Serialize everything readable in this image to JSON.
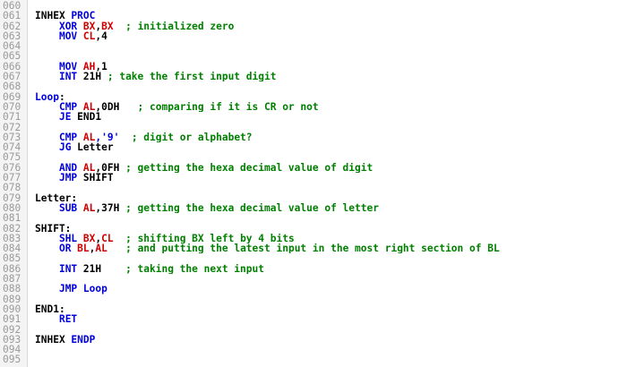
{
  "colors": {
    "background": "#ffffff",
    "line_number": "#9a9a9a",
    "identifier": "#000000",
    "keyword": "#0000dd",
    "register": "#d00000",
    "comment": "#008000"
  },
  "editor": {
    "lines": [
      {
        "n": "060",
        "tokens": []
      },
      {
        "n": "061",
        "tokens": [
          {
            "t": "INHEX ",
            "c": "code"
          },
          {
            "t": "PROC",
            "c": "kw"
          }
        ]
      },
      {
        "n": "062",
        "tokens": [
          {
            "t": "    ",
            "c": "code"
          },
          {
            "t": "XOR ",
            "c": "kw"
          },
          {
            "t": "BX",
            "c": "reg"
          },
          {
            "t": ",",
            "c": "code"
          },
          {
            "t": "BX",
            "c": "reg"
          },
          {
            "t": "  ; initialized zero",
            "c": "cmt"
          }
        ]
      },
      {
        "n": "063",
        "tokens": [
          {
            "t": "    ",
            "c": "code"
          },
          {
            "t": "MOV ",
            "c": "kw"
          },
          {
            "t": "CL",
            "c": "reg"
          },
          {
            "t": ",4",
            "c": "code"
          }
        ]
      },
      {
        "n": "064",
        "tokens": []
      },
      {
        "n": "065",
        "tokens": []
      },
      {
        "n": "066",
        "tokens": [
          {
            "t": "    ",
            "c": "code"
          },
          {
            "t": "MOV ",
            "c": "kw"
          },
          {
            "t": "AH",
            "c": "reg"
          },
          {
            "t": ",1",
            "c": "code"
          }
        ]
      },
      {
        "n": "067",
        "tokens": [
          {
            "t": "    ",
            "c": "code"
          },
          {
            "t": "INT ",
            "c": "kw"
          },
          {
            "t": "21H",
            "c": "code"
          },
          {
            "t": " ; take the first input digit",
            "c": "cmt"
          }
        ]
      },
      {
        "n": "068",
        "tokens": []
      },
      {
        "n": "069",
        "tokens": [
          {
            "t": "Loop",
            "c": "kw"
          },
          {
            "t": ":",
            "c": "code"
          }
        ]
      },
      {
        "n": "070",
        "tokens": [
          {
            "t": "    ",
            "c": "code"
          },
          {
            "t": "CMP ",
            "c": "kw"
          },
          {
            "t": "AL",
            "c": "reg"
          },
          {
            "t": ",0DH",
            "c": "code"
          },
          {
            "t": "   ; comparing if it is CR or not",
            "c": "cmt"
          }
        ]
      },
      {
        "n": "071",
        "tokens": [
          {
            "t": "    ",
            "c": "code"
          },
          {
            "t": "JE ",
            "c": "kw"
          },
          {
            "t": "END1",
            "c": "code"
          }
        ]
      },
      {
        "n": "072",
        "tokens": []
      },
      {
        "n": "073",
        "tokens": [
          {
            "t": "    ",
            "c": "code"
          },
          {
            "t": "CMP ",
            "c": "kw"
          },
          {
            "t": "AL",
            "c": "reg"
          },
          {
            "t": ",'9'",
            "c": "kw"
          },
          {
            "t": "  ; digit or alphabet?",
            "c": "cmt"
          }
        ]
      },
      {
        "n": "074",
        "tokens": [
          {
            "t": "    ",
            "c": "code"
          },
          {
            "t": "JG ",
            "c": "kw"
          },
          {
            "t": "Letter",
            "c": "code"
          }
        ]
      },
      {
        "n": "075",
        "tokens": []
      },
      {
        "n": "076",
        "tokens": [
          {
            "t": "    ",
            "c": "code"
          },
          {
            "t": "AND ",
            "c": "kw"
          },
          {
            "t": "AL",
            "c": "reg"
          },
          {
            "t": ",0FH",
            "c": "code"
          },
          {
            "t": " ; getting the hexa decimal value of digit",
            "c": "cmt"
          }
        ]
      },
      {
        "n": "077",
        "tokens": [
          {
            "t": "    ",
            "c": "code"
          },
          {
            "t": "JMP ",
            "c": "kw"
          },
          {
            "t": "SHIFT",
            "c": "code"
          }
        ]
      },
      {
        "n": "078",
        "tokens": []
      },
      {
        "n": "079",
        "tokens": [
          {
            "t": "Letter:",
            "c": "code"
          }
        ]
      },
      {
        "n": "080",
        "tokens": [
          {
            "t": "    ",
            "c": "code"
          },
          {
            "t": "SUB ",
            "c": "kw"
          },
          {
            "t": "AL",
            "c": "reg"
          },
          {
            "t": ",37H",
            "c": "code"
          },
          {
            "t": " ; getting the hexa decimal value of letter",
            "c": "cmt"
          }
        ]
      },
      {
        "n": "081",
        "tokens": []
      },
      {
        "n": "082",
        "tokens": [
          {
            "t": "SHIFT:",
            "c": "code"
          }
        ]
      },
      {
        "n": "083",
        "tokens": [
          {
            "t": "    ",
            "c": "code"
          },
          {
            "t": "SHL ",
            "c": "kw"
          },
          {
            "t": "BX",
            "c": "reg"
          },
          {
            "t": ",",
            "c": "code"
          },
          {
            "t": "CL",
            "c": "reg"
          },
          {
            "t": "  ; shifting BX left by 4 bits",
            "c": "cmt"
          }
        ]
      },
      {
        "n": "084",
        "tokens": [
          {
            "t": "    ",
            "c": "code"
          },
          {
            "t": "OR ",
            "c": "kw"
          },
          {
            "t": "BL",
            "c": "reg"
          },
          {
            "t": ",",
            "c": "code"
          },
          {
            "t": "AL",
            "c": "reg"
          },
          {
            "t": "   ; and putting the latest input in the most right section of BL",
            "c": "cmt"
          }
        ]
      },
      {
        "n": "085",
        "tokens": []
      },
      {
        "n": "086",
        "tokens": [
          {
            "t": "    ",
            "c": "code"
          },
          {
            "t": "INT ",
            "c": "kw"
          },
          {
            "t": "21H",
            "c": "code"
          },
          {
            "t": "    ; taking the next input",
            "c": "cmt"
          }
        ]
      },
      {
        "n": "087",
        "tokens": []
      },
      {
        "n": "088",
        "tokens": [
          {
            "t": "    ",
            "c": "code"
          },
          {
            "t": "JMP ",
            "c": "kw"
          },
          {
            "t": "Loop",
            "c": "kw"
          }
        ]
      },
      {
        "n": "089",
        "tokens": []
      },
      {
        "n": "090",
        "tokens": [
          {
            "t": "END1:",
            "c": "code"
          }
        ]
      },
      {
        "n": "091",
        "tokens": [
          {
            "t": "    ",
            "c": "code"
          },
          {
            "t": "RET",
            "c": "kw"
          }
        ]
      },
      {
        "n": "092",
        "tokens": []
      },
      {
        "n": "093",
        "tokens": [
          {
            "t": "INHEX ",
            "c": "code"
          },
          {
            "t": "ENDP",
            "c": "kw"
          }
        ]
      },
      {
        "n": "094",
        "tokens": []
      },
      {
        "n": "095",
        "tokens": []
      }
    ]
  }
}
